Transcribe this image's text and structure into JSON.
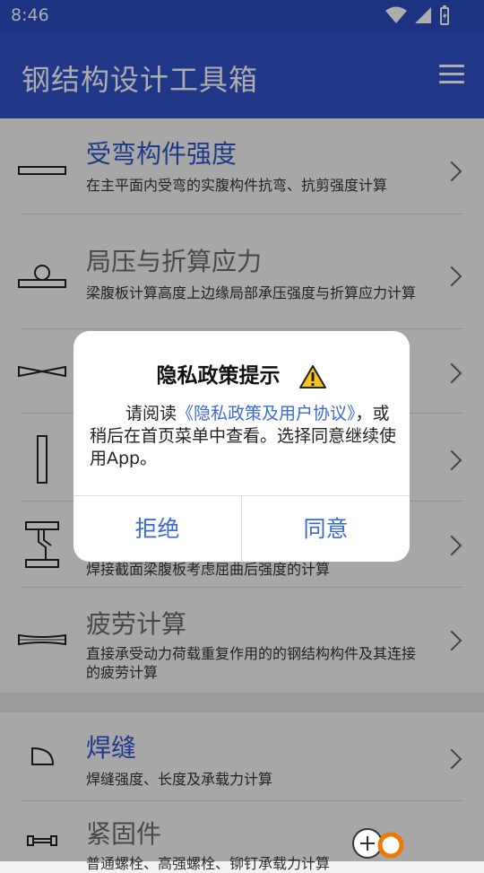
{
  "status": {
    "time": "8:46"
  },
  "appbar": {
    "title": "钢结构设计工具箱"
  },
  "items": [
    {
      "name": "受弯构件强度",
      "desc": "在主平面内受弯的实腹构件抗弯、抗剪强度计算",
      "active": true
    },
    {
      "name": "局压与折算应力",
      "desc": "梁腹板计算高度上边缘局部承压强度与折算应力计算",
      "active": false
    },
    {
      "name": "",
      "desc": "",
      "active": false
    },
    {
      "name": "",
      "desc": "",
      "active": false
    },
    {
      "name": "",
      "desc": "焊接截面梁腹板考虑屈曲后强度的计算",
      "active": false
    },
    {
      "name": "疲劳计算",
      "desc": "直接承受动力荷载重复作用的的钢结构构件及其连接的疲劳计算",
      "active": false
    },
    {
      "name": "焊缝",
      "desc": "焊缝强度、长度及承载力计算",
      "active": true
    },
    {
      "name": "紧固件",
      "desc": "普通螺栓、高强螺栓、铆钉承载力计算",
      "active": false
    }
  ],
  "dialog": {
    "title": "隐私政策提示",
    "body_prefix": "请阅读",
    "body_link": "《隐私政策及用户协议》",
    "body_suffix": "，或稍后在首页菜单中查看。选择同意继续使用App。",
    "reject": "拒绝",
    "agree": "同意"
  }
}
